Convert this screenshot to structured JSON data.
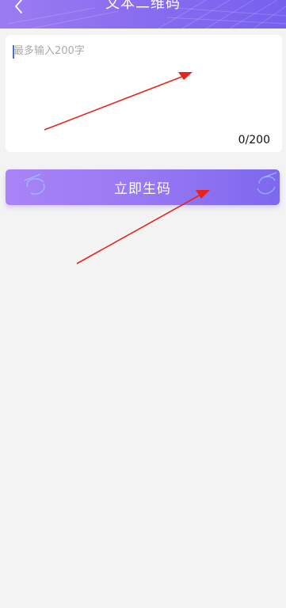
{
  "header": {
    "title": "文本二维码",
    "back_icon": "chevron-left-icon"
  },
  "input": {
    "placeholder": "最多输入200字",
    "value": "",
    "counter": "0/200"
  },
  "generate_button": {
    "label": "立即生码"
  },
  "colors": {
    "header_start": "#9b7cf1",
    "header_end": "#7660ee",
    "button_start": "#a984f8",
    "button_end": "#7d68ee",
    "background": "#f3f3f3",
    "annotation_arrow": "#e8231c"
  }
}
